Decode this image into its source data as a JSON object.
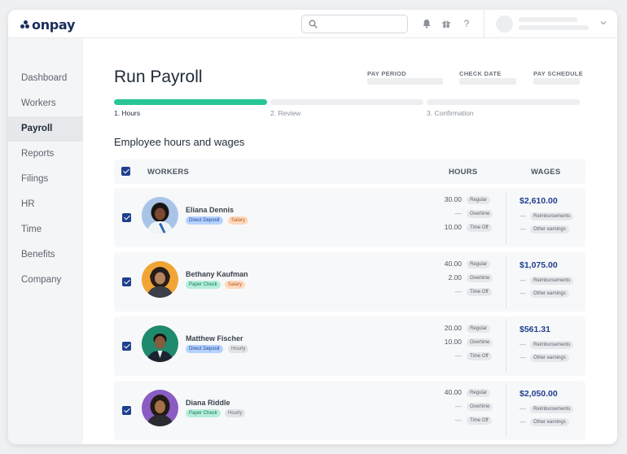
{
  "app": {
    "logo_text": "onpay",
    "brand_color": "#1c2d5a",
    "accent_color": "#28c596"
  },
  "sidebar": {
    "items": [
      {
        "label": "Dashboard"
      },
      {
        "label": "Workers"
      },
      {
        "label": "Payroll",
        "active": true
      },
      {
        "label": "Reports"
      },
      {
        "label": "Filings"
      },
      {
        "label": "HR"
      },
      {
        "label": "Time"
      },
      {
        "label": "Benefits"
      },
      {
        "label": "Company"
      }
    ]
  },
  "header": {
    "title": "Run Payroll",
    "meta": [
      "PAY PERIOD",
      "CHECK DATE",
      "PAY SCHEDULE"
    ]
  },
  "steps": [
    {
      "label": "1. Hours",
      "state": "current",
      "progress": 1
    },
    {
      "label": "2. Review",
      "state": "upcoming",
      "progress": 0
    },
    {
      "label": "3. Confirmation",
      "state": "upcoming",
      "progress": 0
    }
  ],
  "section": {
    "title": "Employee hours and wages"
  },
  "table": {
    "headers": {
      "workers": "WORKERS",
      "hours": "HOURS",
      "wages": "WAGES"
    },
    "hour_types": [
      "Regular",
      "Overtime",
      "Time Off"
    ],
    "wage_items": [
      "Reimbursements",
      "Other earnings"
    ],
    "rows": [
      {
        "name": "Eliana Dennis",
        "payment": "Direct Deposit",
        "pay_type": "Salary",
        "hours": [
          "30.00",
          "—",
          "10.00"
        ],
        "wage": "$2,610.00"
      },
      {
        "name": "Bethany Kaufman",
        "payment": "Paper Check",
        "pay_type": "Salary",
        "hours": [
          "40.00",
          "2.00",
          "—"
        ],
        "wage": "$1,075.00"
      },
      {
        "name": "Matthew Fischer",
        "payment": "Direct Deposit",
        "pay_type": "Hourly",
        "hours": [
          "20.00",
          "10.00",
          "—"
        ],
        "wage": "$561.31"
      },
      {
        "name": "Diana Riddle",
        "payment": "Paper Check",
        "pay_type": "Hourly",
        "hours": [
          "40.00",
          "—",
          "—"
        ],
        "wage": "$2,050.00"
      }
    ]
  }
}
